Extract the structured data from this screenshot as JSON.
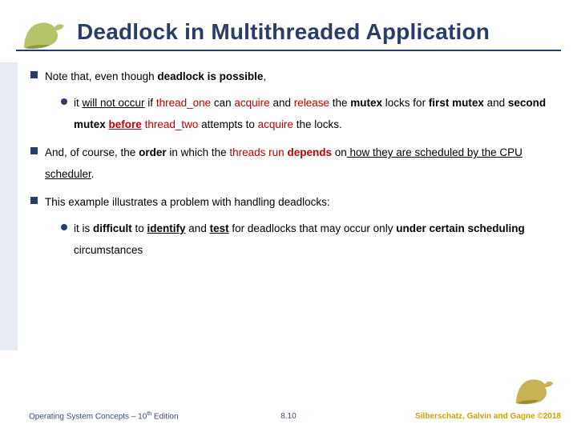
{
  "title": "Deadlock in Multithreaded Application",
  "bullets": {
    "b1_pre": "Note that, even though ",
    "b1_bold": "deadlock is possible",
    "b1_post": ",",
    "b1s_1": "it ",
    "b1s_2": "will not occur",
    "b1s_3": " if ",
    "b1s_4": "thread_one",
    "b1s_5": " can ",
    "b1s_6": "acquire",
    "b1s_7": " and ",
    "b1s_8": "release",
    "b1s_9": " the ",
    "b1s_10": "mutex",
    "b1s_11": " locks for ",
    "b1s_12": "first mutex",
    "b1s_13": " and ",
    "b1s_14": "second mutex",
    "b1s_15": " ",
    "b1s_16": "before",
    "b1s_17": " ",
    "b1s_18": "thread_two",
    "b1s_19": " attempts to ",
    "b1s_20": "acquire",
    "b1s_21": " the locks.",
    "b2_1": "And, of course, the ",
    "b2_2": "order",
    "b2_3": " in which the ",
    "b2_4": "threads run",
    "b2_5": " ",
    "b2_6": "depends",
    "b2_7": " on",
    "b2_8": " how they are scheduled by the CPU scheduler",
    "b2_9": ".",
    "b3": "This example illustrates a problem with handling deadlocks:",
    "b3s_1": "it is ",
    "b3s_2": "difficult",
    "b3s_3": " to ",
    "b3s_4": "identify",
    "b3s_5": " and ",
    "b3s_6": "test",
    "b3s_7": " for deadlocks that may occur only ",
    "b3s_8": "under certain scheduling",
    "b3s_9": " circumstances"
  },
  "footer": {
    "left_a": "Operating System Concepts – 10",
    "left_b": "th",
    "left_c": " Edition",
    "mid": "8.10",
    "right": "Silberschatz, Galvin and Gagne ©2018"
  }
}
